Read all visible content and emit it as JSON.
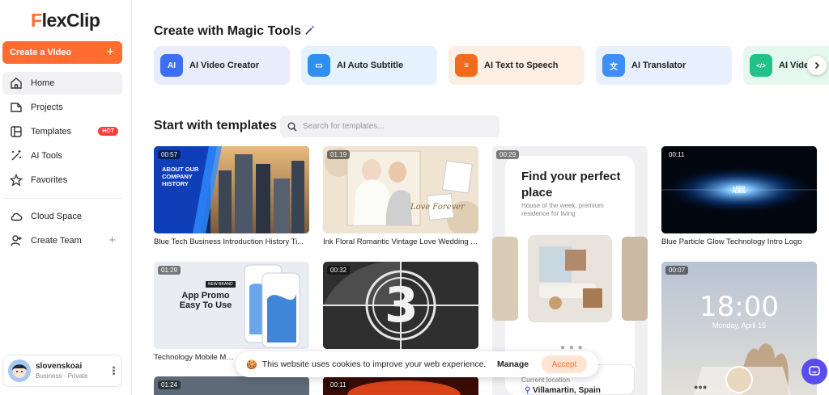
{
  "sidebar": {
    "logo_prefix": "F",
    "logo_rest": "lexClip",
    "create_label": "Create a Video",
    "create_plus": "+",
    "items": [
      {
        "label": "Home"
      },
      {
        "label": "Projects"
      },
      {
        "label": "Templates",
        "badge": "HOT"
      },
      {
        "label": "AI Tools"
      },
      {
        "label": "Favorites"
      },
      {
        "label": "Cloud Space"
      },
      {
        "label": "Create Team",
        "plus": "+"
      }
    ],
    "user": {
      "name": "slovenskoai",
      "plan": "Business · Private"
    }
  },
  "magic": {
    "title": "Create with Magic Tools",
    "tools": [
      {
        "label": "AI Video Creator",
        "icon": "AI",
        "color": "#3d6ff5",
        "bg": "#e9edfb"
      },
      {
        "label": "AI Auto Subtitle",
        "icon": "▭",
        "color": "#2d8ff0",
        "bg": "#e5f1fc"
      },
      {
        "label": "AI Text to Speech",
        "icon": "≡",
        "color": "#f26a1b",
        "bg": "#fdeee4"
      },
      {
        "label": "AI Translator",
        "icon": "文",
        "color": "#3d8ef5",
        "bg": "#e7f0fc"
      },
      {
        "label": "AI Video",
        "icon": "</>",
        "color": "#21c18a",
        "bg": "#e4f8ef"
      }
    ]
  },
  "templates": {
    "title": "Start with templates",
    "search_placeholder": "Search for templates...",
    "cards": [
      {
        "duration": "00:57",
        "title": "Blue Tech Business Introduction History Ti...",
        "overlay": "ABOUT OUR COMPANY HISTORY"
      },
      {
        "duration": "01:19",
        "title": "Ink Floral Romantic Vintage Love Wedding A...",
        "overlay": "Love Forever"
      },
      {
        "duration": "00:29",
        "headline": "Find your perfect place",
        "sub": "House of the week, premium residence for living",
        "location_label": "Current location",
        "location": "Villamartin, Spain"
      },
      {
        "duration": "00:11",
        "title": "Blue Particle Glow Technology Intro Logo",
        "overlay": "LOGO PLACE"
      },
      {
        "duration": "01:29",
        "title": "Technology Mobile Mock",
        "overlay_badge": "NEW BRAND",
        "overlay": "App Promo Easy To Use"
      },
      {
        "duration": "00:32",
        "overlay": "3"
      },
      {
        "duration": "00:07",
        "overlay": "18:00",
        "sub": "Monday, April 15"
      },
      {
        "duration": "01:24"
      },
      {
        "duration": "00:11"
      }
    ]
  },
  "cookie": {
    "text": "This website uses cookies to improve your web experience.",
    "manage": "Manage",
    "accept": "Accept"
  },
  "colors": {
    "accent": "#ff6c2f",
    "hot": "#ff3b3b",
    "chat": "#5a4df0"
  }
}
